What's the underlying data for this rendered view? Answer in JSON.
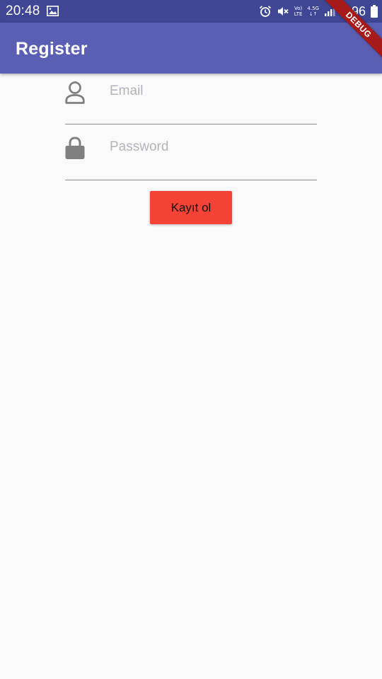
{
  "status_bar": {
    "time": "20:48",
    "volte_top": "Vo)",
    "volte_bottom": "LTE",
    "network_top": "4.5G",
    "network_bottom": "↓↑",
    "battery_percent": "%96",
    "icons": [
      "gallery-icon",
      "alarm-icon",
      "mute-icon",
      "volte-icon",
      "network-4.5g-icon",
      "signal-icon",
      "battery-icon"
    ]
  },
  "app_bar": {
    "title": "Register",
    "color": "#5a5fb3"
  },
  "debug_banner": {
    "label": "DEBUG",
    "color": "#a61a1a"
  },
  "form": {
    "email": {
      "placeholder": "Email",
      "value": "",
      "icon": "person-icon"
    },
    "password": {
      "placeholder": "Password",
      "value": "",
      "icon": "lock-icon"
    },
    "submit": {
      "label": "Kayıt ol",
      "color": "#f44336"
    }
  }
}
